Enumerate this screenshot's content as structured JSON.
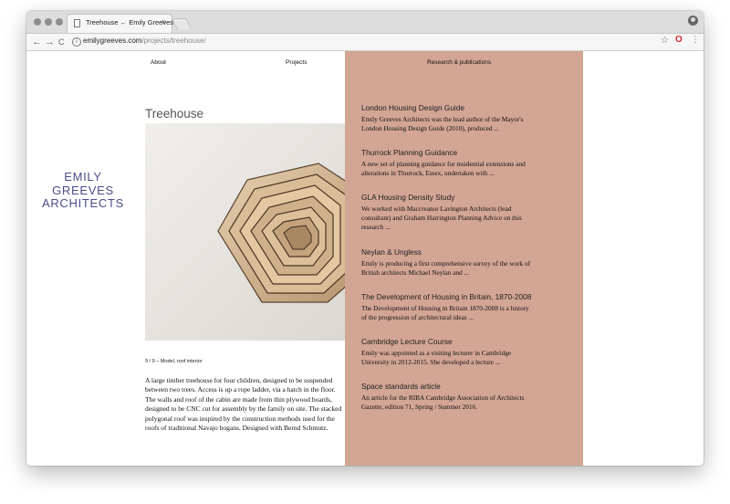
{
  "browser": {
    "tab_title": "Treehouse ← Emily Greeves",
    "tab_close": "×",
    "url_host": "emilygreeves.com",
    "url_path": "/projects/treehouse/",
    "info": "i",
    "back": "←",
    "forward": "→",
    "reload": "C",
    "star": "☆",
    "opera": "O",
    "menu": "⋮"
  },
  "nav": {
    "about": "About",
    "projects": "Projects",
    "research": "Research & publications"
  },
  "logo": {
    "line1": "EMILY",
    "line2": "GREEVES",
    "line3": "ARCHITECTS"
  },
  "project": {
    "title": "Treehouse",
    "caption": "9 / 9 – Model, roof interior",
    "description_lines": [
      "A large timber treehouse for four children, designed to be suspended",
      "between two trees. Access is up a rope ladder, via a hatch in the floor.",
      "The walls and roof of the cabin are made from thin plywood boards,",
      "designed to be CNC cut for assembly by the family on site. The stacked",
      "polygonal roof was inspired by the construction methods used for the",
      "roofs of traditional Navajo hogans. Designed with Bernd Schmutz."
    ]
  },
  "research": [
    {
      "title": "London Housing Design Guide",
      "lines": [
        "Emily Greeves Architects was the lead author of the Mayor's",
        "London Housing Design Guide (2010), produced ..."
      ]
    },
    {
      "title": "Thurrock Planning Guidance",
      "lines": [
        "A new set of planning guidance for residential extensions and",
        "alterations in Thurrock, Essex, undertaken with ..."
      ]
    },
    {
      "title": "GLA Housing Density Study",
      "lines": [
        "We worked with Maccreanor Lavington Architects (lead",
        "consultant) and Graham Harrington Planning Advice on this",
        "research ..."
      ]
    },
    {
      "title": "Neylan & Ungless",
      "lines": [
        "Emily is producing a first comprehensive survey of the work of",
        "British architects Michael Neylan and ..."
      ]
    },
    {
      "title": "The Development of Housing in Britain, 1870-2008",
      "lines": [
        "The Development of Housing in Britain 1870-2008 is a history",
        "of the progression of architectural ideas ..."
      ]
    },
    {
      "title": "Cambridge Lecture Course",
      "lines": [
        "Emily was appointed as a visiting lecturer in Cambridge",
        "University in 2012-2015. She developed a lecture ..."
      ]
    },
    {
      "title": "Space standards article",
      "lines": [
        "An article for the RIBA Cambridge Association of Architects",
        "Gazette, edition 71, Spring / Summer 2016."
      ]
    }
  ],
  "colors": {
    "panel": "#d3a595",
    "logo": "#4a4e8a"
  }
}
